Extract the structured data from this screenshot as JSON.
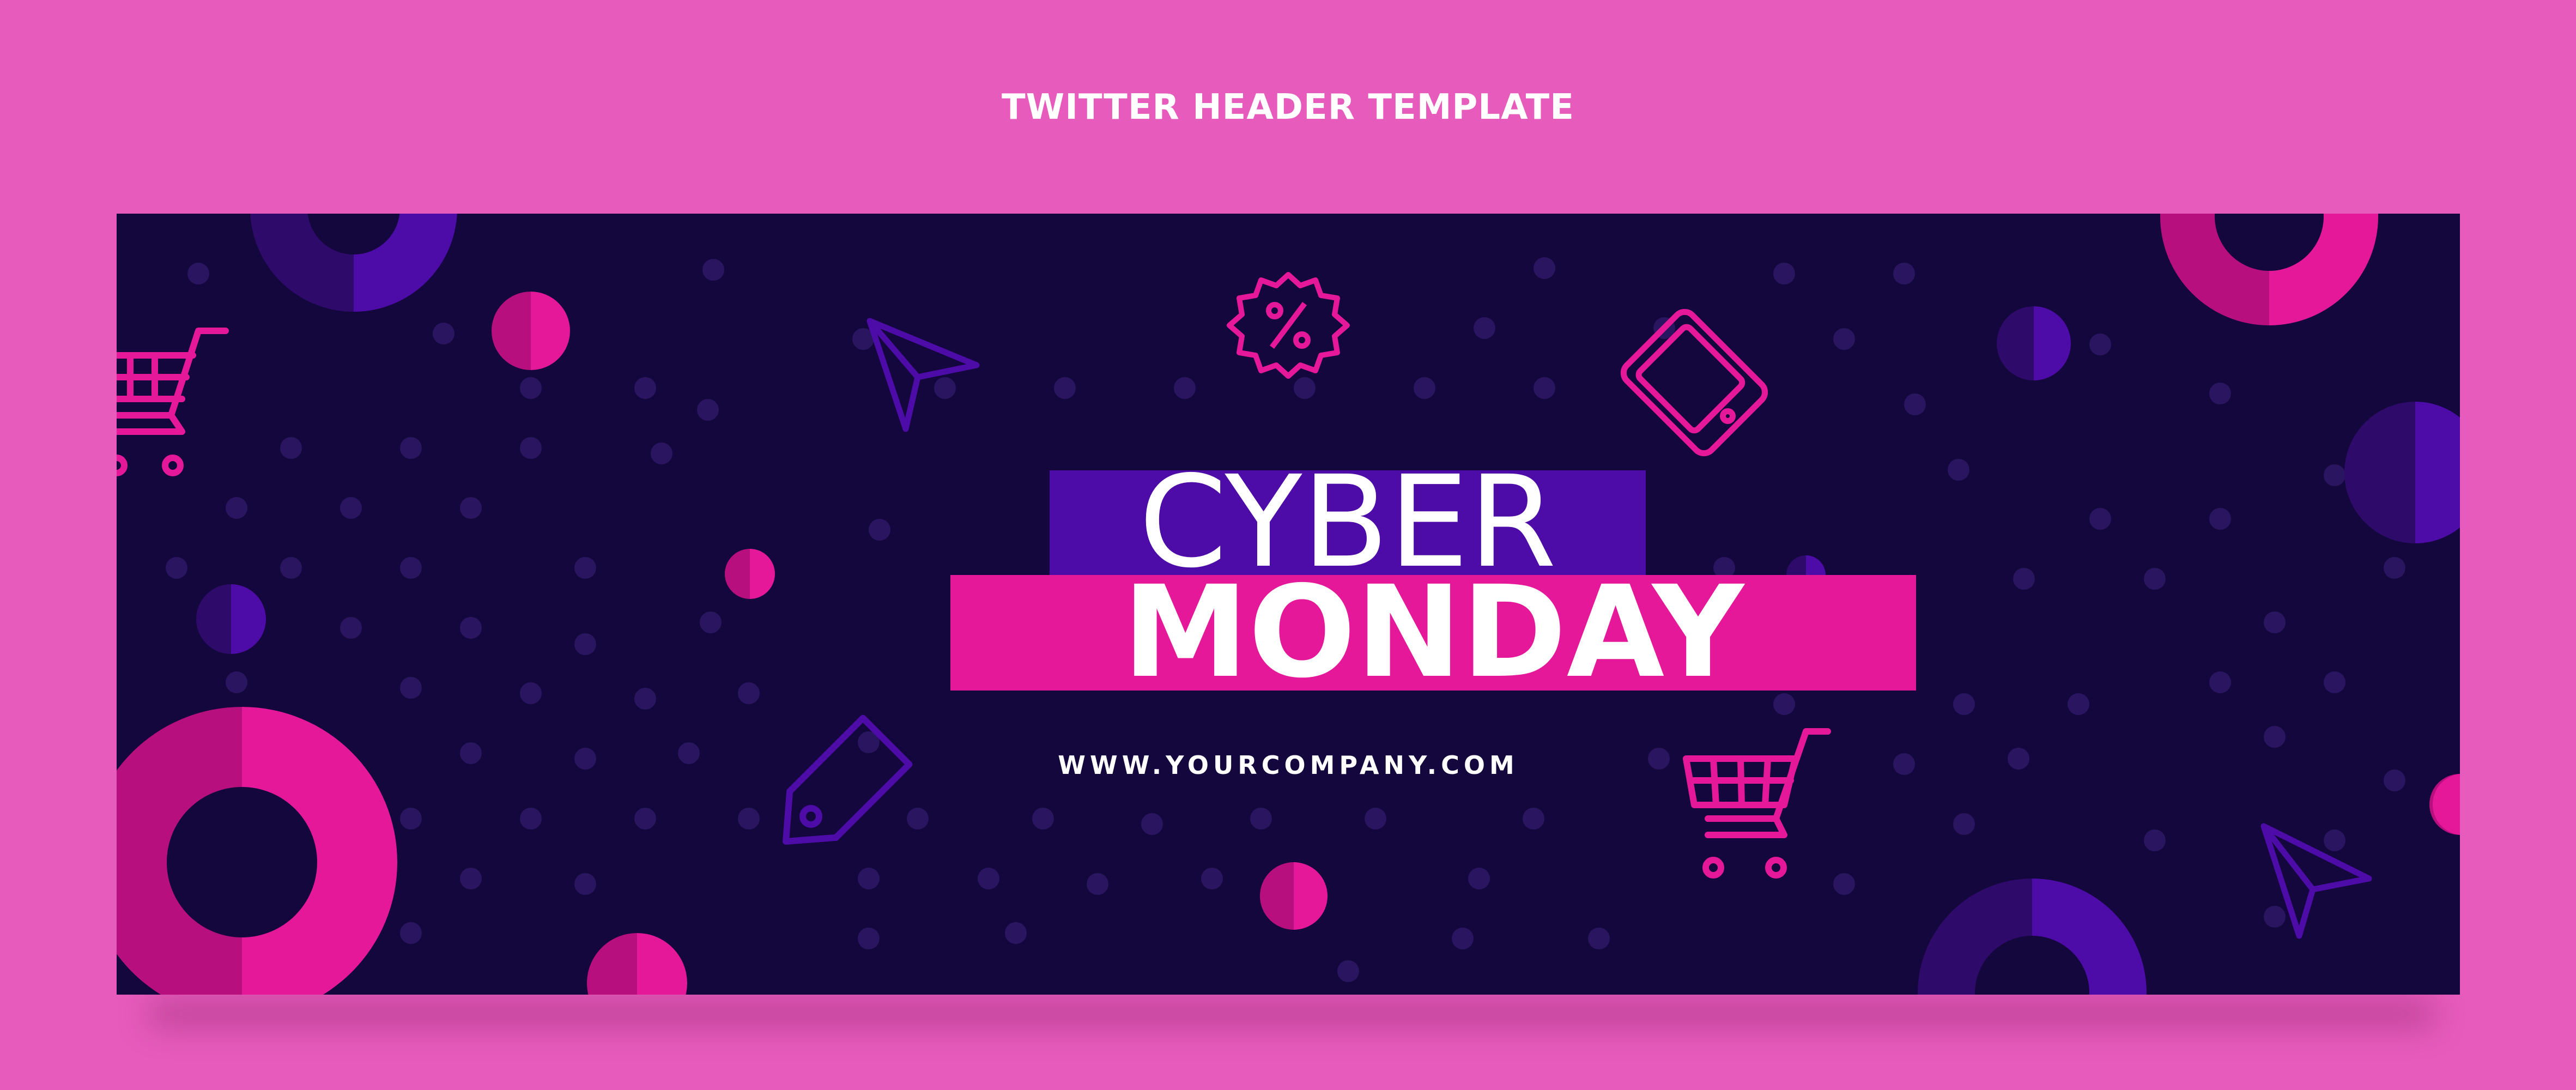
{
  "page": {
    "title": "TWITTER HEADER TEMPLATE"
  },
  "banner": {
    "headline_line1": "CYBER",
    "headline_line2": "MONDAY",
    "website": "WWW.YOURCOMPANY.COM",
    "icons": [
      "shopping-cart-icon",
      "percent-badge-icon",
      "paper-plane-icon",
      "smartphone-icon",
      "price-tag-icon"
    ]
  },
  "colors": {
    "page_background": "#e65bbb",
    "banner_background": "#14073d",
    "dot_color": "#2a1660",
    "accent_pink": "#e5189a",
    "accent_purple": "#4d0ba7",
    "text_color": "#ffffff"
  }
}
